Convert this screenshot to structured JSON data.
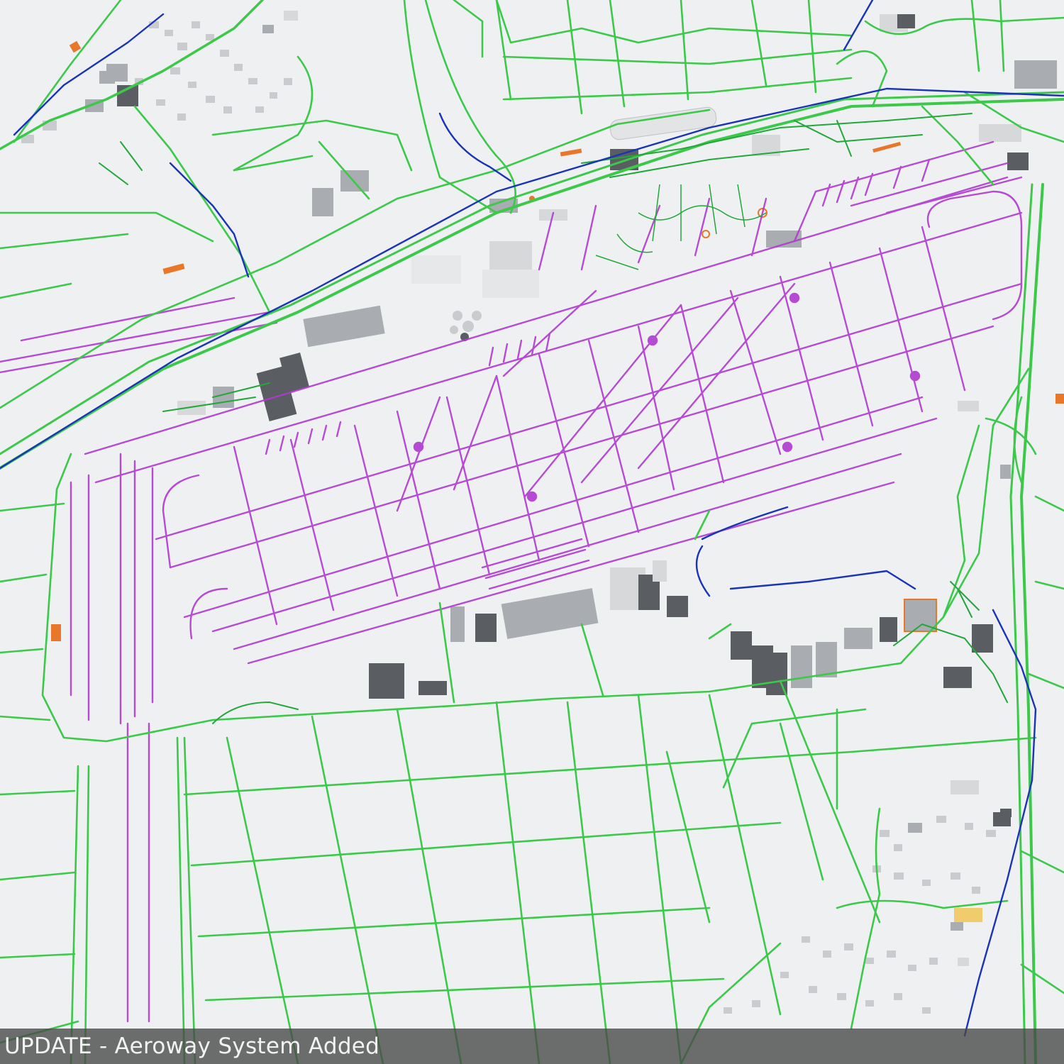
{
  "caption": {
    "text": "UPDATE - Aeroway System Added"
  },
  "colors": {
    "background": "#eef0f2",
    "road": "#3cc94a",
    "road_dark": "#22a83a",
    "aeroway": "#b03ad0",
    "railway": "#1a34b8",
    "building_light": "#d6d8da",
    "building_mid": "#a9acb0",
    "building_dark": "#5a5d61",
    "accent_orange": "#e8772a"
  },
  "legend_semantics": {
    "roads": "green",
    "aeroways": "magenta",
    "railways": "blue",
    "buildings": "grey"
  }
}
